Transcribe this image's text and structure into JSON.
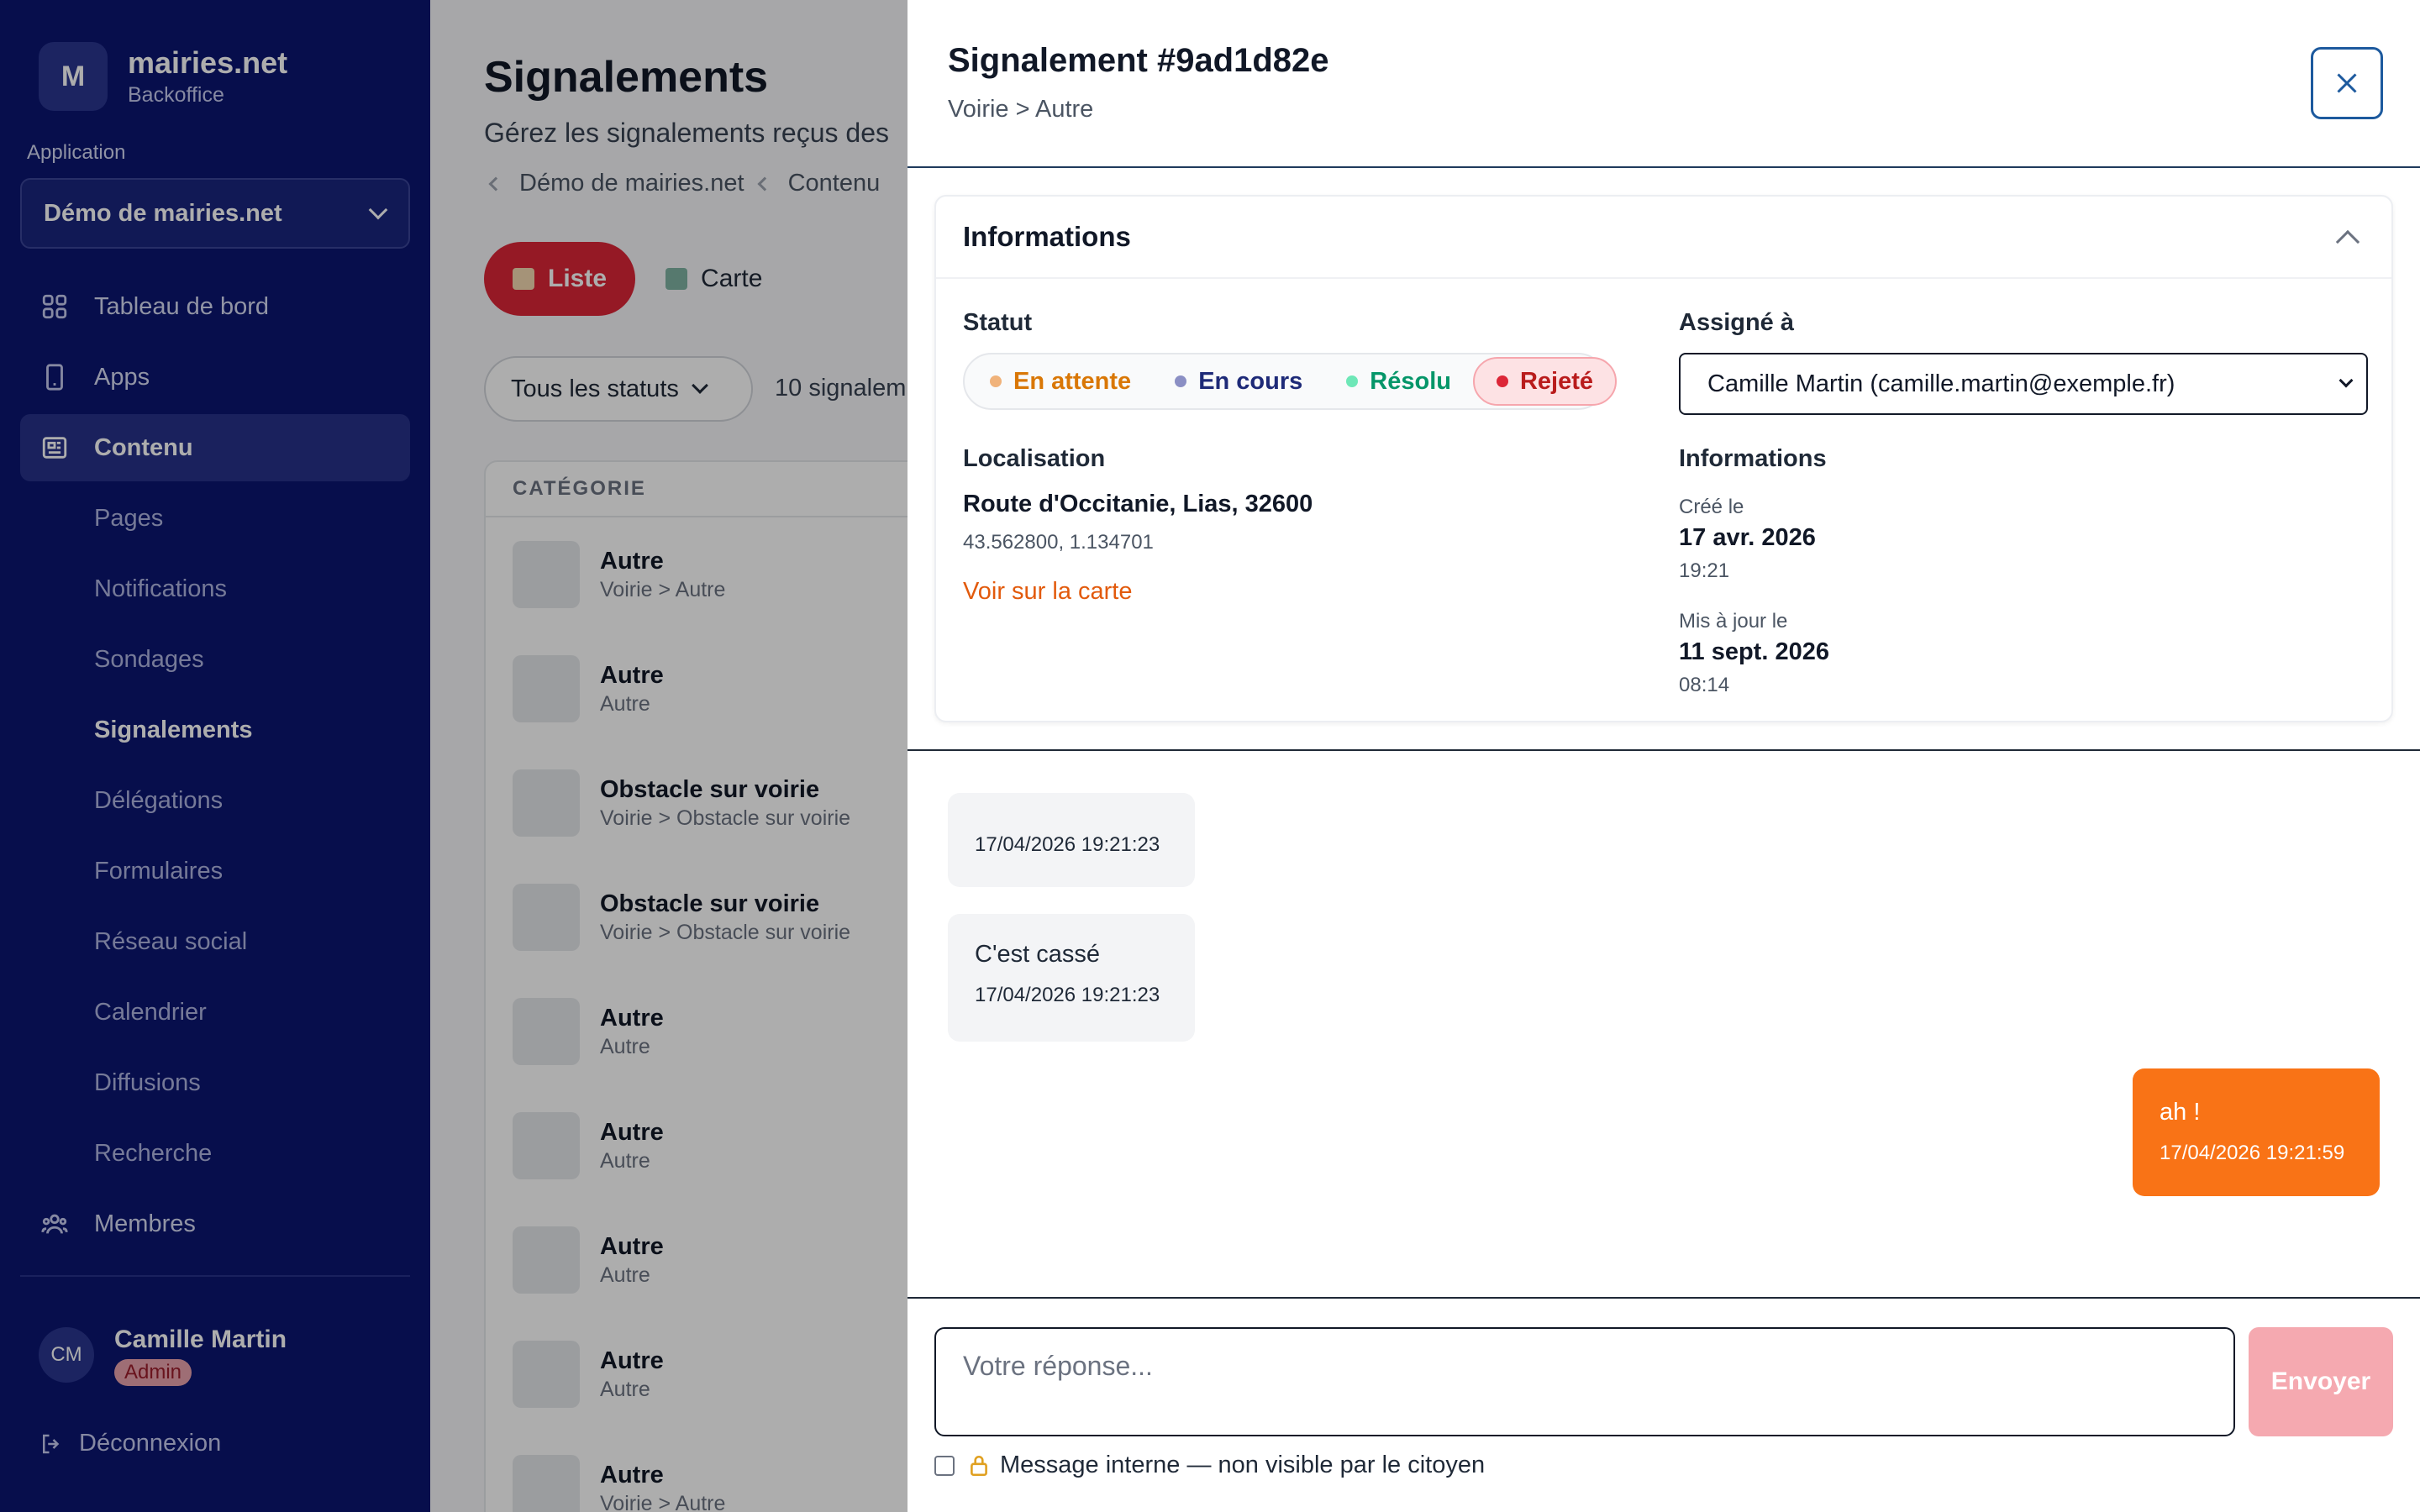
{
  "colors": {
    "sidebar": "#0b1570",
    "accent_red": "#dc2637",
    "accent_orange": "#f97316",
    "link_orange": "#e25a0c"
  },
  "brand": {
    "logo_letter": "M",
    "name": "mairies.net",
    "subtitle": "Backoffice"
  },
  "sidebar": {
    "app_label": "Application",
    "app_selected": "Démo de mairies.net",
    "nav": [
      {
        "label": "Tableau de bord",
        "icon": "grid-icon"
      },
      {
        "label": "Apps",
        "icon": "phone-icon"
      },
      {
        "label": "Contenu",
        "icon": "newspaper-icon"
      }
    ],
    "sub": [
      "Pages",
      "Notifications",
      "Sondages",
      "Signalements",
      "Délégations",
      "Formulaires",
      "Réseau social",
      "Calendrier",
      "Diffusions",
      "Recherche"
    ],
    "members": {
      "label": "Membres",
      "icon": "users-icon"
    },
    "user": {
      "initials": "CM",
      "name": "Camille Martin",
      "role": "Admin"
    },
    "logout": "Déconnexion"
  },
  "main": {
    "title": "Signalements",
    "description": "Gérez les signalements reçus des",
    "breadcrumb": [
      "Démo de mairies.net",
      "Contenu"
    ],
    "tabs": {
      "list": "Liste",
      "map": "Carte"
    },
    "filter": "Tous les statuts",
    "count": "10 signalem",
    "table_header": "CATÉGORIE",
    "rows": [
      {
        "title": "Autre",
        "sub": "Voirie > Autre"
      },
      {
        "title": "Autre",
        "sub": "Autre"
      },
      {
        "title": "Obstacle sur voirie",
        "sub": "Voirie > Obstacle sur voirie"
      },
      {
        "title": "Obstacle sur voirie",
        "sub": "Voirie > Obstacle sur voirie"
      },
      {
        "title": "Autre",
        "sub": "Autre"
      },
      {
        "title": "Autre",
        "sub": "Autre"
      },
      {
        "title": "Autre",
        "sub": "Autre"
      },
      {
        "title": "Autre",
        "sub": "Autre"
      },
      {
        "title": "Autre",
        "sub": "Voirie > Autre"
      }
    ]
  },
  "drawer": {
    "title": "Signalement #9ad1d82e",
    "subtitle": "Voirie > Autre",
    "info": {
      "title": "Informations",
      "statut_label": "Statut",
      "statuses": [
        {
          "label": "En attente",
          "color": "#d97706",
          "dot": "#f0b27a"
        },
        {
          "label": "En cours",
          "color": "#1e2a78",
          "dot": "#8b8fc4"
        },
        {
          "label": "Résolu",
          "color": "#059669",
          "dot": "#6ee7b7"
        },
        {
          "label": "Rejeté",
          "color": "#b91c1c",
          "dot": "#dc2637"
        }
      ],
      "selected_status": "Rejeté",
      "assign_label": "Assigné à",
      "assignee": "Camille Martin (camille.martin@exemple.fr)",
      "loc_label": "Localisation",
      "address": "Route d'Occitanie, Lias, 32600",
      "coords": "43.562800, 1.134701",
      "map_link": "Voir sur la carte",
      "meta_label": "Informations",
      "created_label": "Créé le",
      "created_date": "17 avr. 2026",
      "created_time": "19:21",
      "updated_label": "Mis à jour le",
      "updated_date": "11 sept. 2026",
      "updated_time": "08:14"
    },
    "messages": [
      {
        "text": "",
        "time": "17/04/2026 19:21:23",
        "from": "citizen"
      },
      {
        "text": "C'est cassé",
        "time": "17/04/2026 19:21:23",
        "from": "citizen"
      },
      {
        "text": "ah !",
        "time": "17/04/2026 19:21:59",
        "from": "agent"
      }
    ],
    "composer": {
      "placeholder": "Votre réponse...",
      "send": "Envoyer",
      "internal_label": "Message interne — non visible par le citoyen"
    }
  }
}
